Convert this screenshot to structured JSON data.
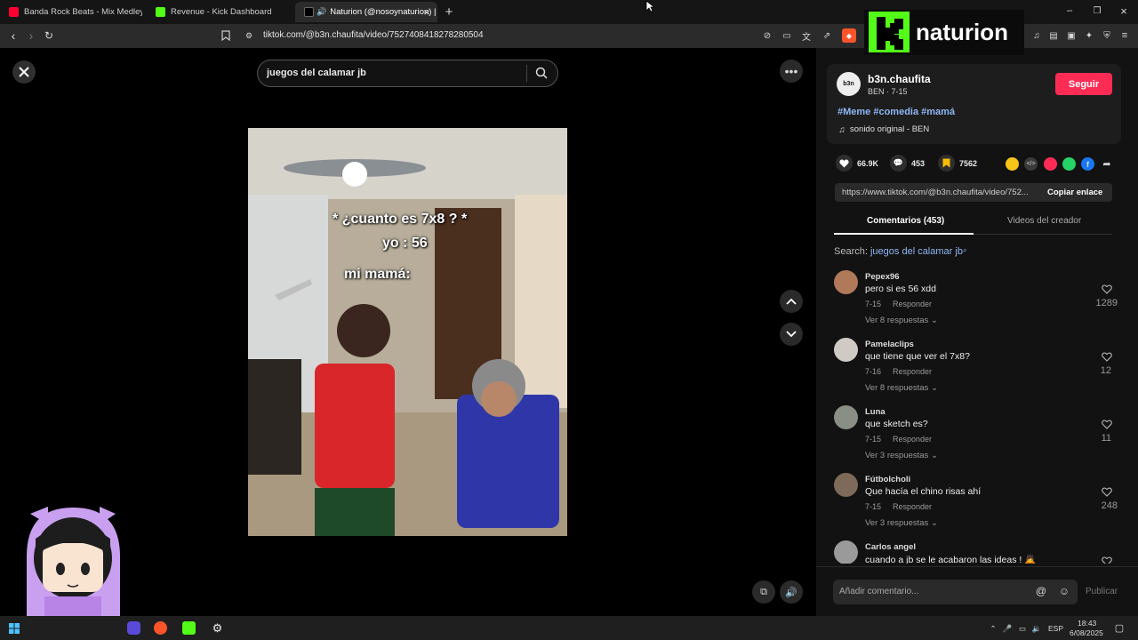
{
  "browser": {
    "tabs": [
      {
        "label": "Banda Rock Beats - Mix Medley Pop",
        "favicon_color": "#ff0033"
      },
      {
        "label": "Revenue - Kick Dashboard",
        "favicon_color": "#53fc18"
      },
      {
        "label": "Naturion (@nosoynaturion) |",
        "favicon_color": "#000000"
      }
    ],
    "url": "tiktok.com/@b3n.chaufita/video/7527408418278280504"
  },
  "video": {
    "search_query": "juegos del calamar jb",
    "caption_1": "* ¿cuanto es 7x8 ? *",
    "caption_2": "yo : 56",
    "caption_3": "mi mamá:"
  },
  "creator": {
    "avatar_text": "b3n",
    "username": "b3n.chaufita",
    "subline": "BEN · 7-15",
    "follow_label": "Seguir",
    "hashtags": "#Meme #comedia #mamá",
    "sound": "sonido original - BEN"
  },
  "stats": {
    "likes": "66.9K",
    "comments": "453",
    "saves": "7562"
  },
  "share": {
    "link": "https://www.tiktok.com/@b3n.chaufita/video/752...",
    "copy_label": "Copiar enlace",
    "icon_colors": [
      "#f5c518",
      "#3a3a3a",
      "#fe2c55",
      "#25d366",
      "#1877f2"
    ]
  },
  "panel_tabs": {
    "comments": "Comentarios (453)",
    "creator_videos": "Videos del creador"
  },
  "search_line": {
    "prefix": "Search:",
    "query": "juegos del calamar jb"
  },
  "comments": [
    {
      "user": "Pepex96",
      "text": "pero si es 56 xdd",
      "date": "7-15",
      "reply": "Responder",
      "more": "Ver 8 respuestas",
      "likes": "1289",
      "avatar_color": "#b07a5a"
    },
    {
      "user": "Pamelaclips",
      "text": "que tiene que ver el 7x8?",
      "date": "7-16",
      "reply": "Responder",
      "more": "Ver 8 respuestas",
      "likes": "12",
      "avatar_color": "#cfcac4"
    },
    {
      "user": "Luna",
      "text": "que sketch es?",
      "date": "7-15",
      "reply": "Responder",
      "more": "Ver 3 respuestas",
      "likes": "11",
      "avatar_color": "#8a8f85"
    },
    {
      "user": "Fútbolcholi",
      "text": "Que hacía el chino risas ahí",
      "date": "7-15",
      "reply": "Responder",
      "more": "Ver 3 respuestas",
      "likes": "248",
      "avatar_color": "#7e6a58"
    },
    {
      "user": "Carlos angel",
      "text": "cuando a jb se le acabaron las ideas ! 🙇",
      "date": "",
      "reply": "",
      "more": "",
      "likes": "",
      "avatar_color": "#9a9a9a"
    }
  ],
  "composer": {
    "placeholder": "Añadir comentario...",
    "publish": "Publicar"
  },
  "overlay": {
    "brand": "naturion",
    "brand_color": "#53fc18"
  },
  "taskbar": {
    "lang": "ESP",
    "time": "18:43",
    "date": "6/08/2025"
  }
}
